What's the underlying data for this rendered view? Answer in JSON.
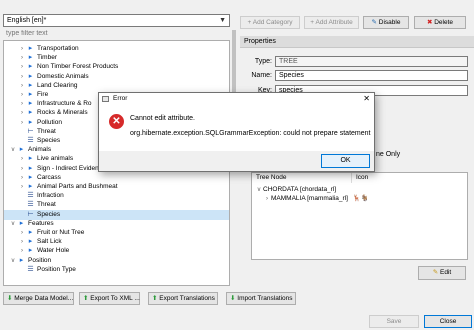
{
  "language_select": {
    "value": "English [en]*"
  },
  "filter": {
    "placeholder": "type filter text"
  },
  "tree": [
    {
      "label": "Transportation",
      "depth": 2,
      "type": "folder",
      "expand": "collapsed"
    },
    {
      "label": "Timber",
      "depth": 2,
      "type": "folder",
      "expand": "collapsed"
    },
    {
      "label": "Non Timber Forest Products",
      "depth": 2,
      "type": "folder",
      "expand": "collapsed"
    },
    {
      "label": "Domestic Animals",
      "depth": 2,
      "type": "folder",
      "expand": "collapsed"
    },
    {
      "label": "Land Clearing",
      "depth": 2,
      "type": "folder",
      "expand": "collapsed"
    },
    {
      "label": "Fire",
      "depth": 2,
      "type": "folder",
      "expand": "collapsed"
    },
    {
      "label": "Infrastructure & Ro",
      "depth": 2,
      "type": "folder",
      "expand": "collapsed"
    },
    {
      "label": "Rocks & Minerals",
      "depth": 2,
      "type": "folder",
      "expand": "collapsed"
    },
    {
      "label": "Pollution",
      "depth": 2,
      "type": "folder",
      "expand": "collapsed"
    },
    {
      "label": "Threat",
      "depth": 2,
      "type": "category",
      "expand": "none"
    },
    {
      "label": "Species",
      "depth": 2,
      "type": "list",
      "expand": "none"
    },
    {
      "label": "Animals",
      "depth": 1,
      "type": "folder",
      "expand": "expanded"
    },
    {
      "label": "Live animals",
      "depth": 2,
      "type": "folder",
      "expand": "collapsed"
    },
    {
      "label": "Sign - Indirect Evidence",
      "depth": 2,
      "type": "folder",
      "expand": "collapsed"
    },
    {
      "label": "Carcass",
      "depth": 2,
      "type": "folder",
      "expand": "collapsed"
    },
    {
      "label": "Animal Parts and Bushmeat",
      "depth": 2,
      "type": "folder",
      "expand": "collapsed"
    },
    {
      "label": "Infraction",
      "depth": 2,
      "type": "list",
      "expand": "none"
    },
    {
      "label": "Threat",
      "depth": 2,
      "type": "list",
      "expand": "none"
    },
    {
      "label": "Species",
      "depth": 2,
      "type": "category",
      "expand": "none",
      "selected": true
    },
    {
      "label": "Features",
      "depth": 1,
      "type": "folder",
      "expand": "expanded"
    },
    {
      "label": "Fruit or Nut Tree",
      "depth": 2,
      "type": "folder",
      "expand": "collapsed"
    },
    {
      "label": "Salt Lick",
      "depth": 2,
      "type": "folder",
      "expand": "collapsed"
    },
    {
      "label": "Water Hole",
      "depth": 2,
      "type": "folder",
      "expand": "collapsed"
    },
    {
      "label": "Position",
      "depth": 1,
      "type": "folder",
      "expand": "expanded"
    },
    {
      "label": "Position Type",
      "depth": 2,
      "type": "list",
      "expand": "none"
    }
  ],
  "toolbar": {
    "add_category": "Add Category",
    "add_attribute": "Add Attribute",
    "disable": "Disable",
    "delete": "Delete"
  },
  "properties": {
    "header": "Properties",
    "type_label": "Type:",
    "type_value": "TREE",
    "name_label": "Name:",
    "name_value": "Species",
    "key_label": "Key:",
    "key_value": "species",
    "partial_text": "ne Only"
  },
  "tree_table": {
    "col_node": "Tree Node",
    "col_icon": "Icon",
    "rows": [
      {
        "label": "CHORDATA [chordata_rl]",
        "expand": "expanded"
      },
      {
        "label": "MAMMALIA [mammalia_rl]",
        "expand": "collapsed"
      }
    ]
  },
  "edit_button": "Edit",
  "bottom": {
    "merge": "Merge Data Model...",
    "export_xml": "Export To XML ...",
    "export_translations": "Export Translations",
    "import_translations": "Import Translations",
    "save": "Save",
    "close": "Close"
  },
  "dialog": {
    "title": "Error",
    "message": "Cannot edit attribute.",
    "detail": "org.hibernate.exception.SQLGrammarException: could not prepare statement",
    "ok": "OK"
  }
}
